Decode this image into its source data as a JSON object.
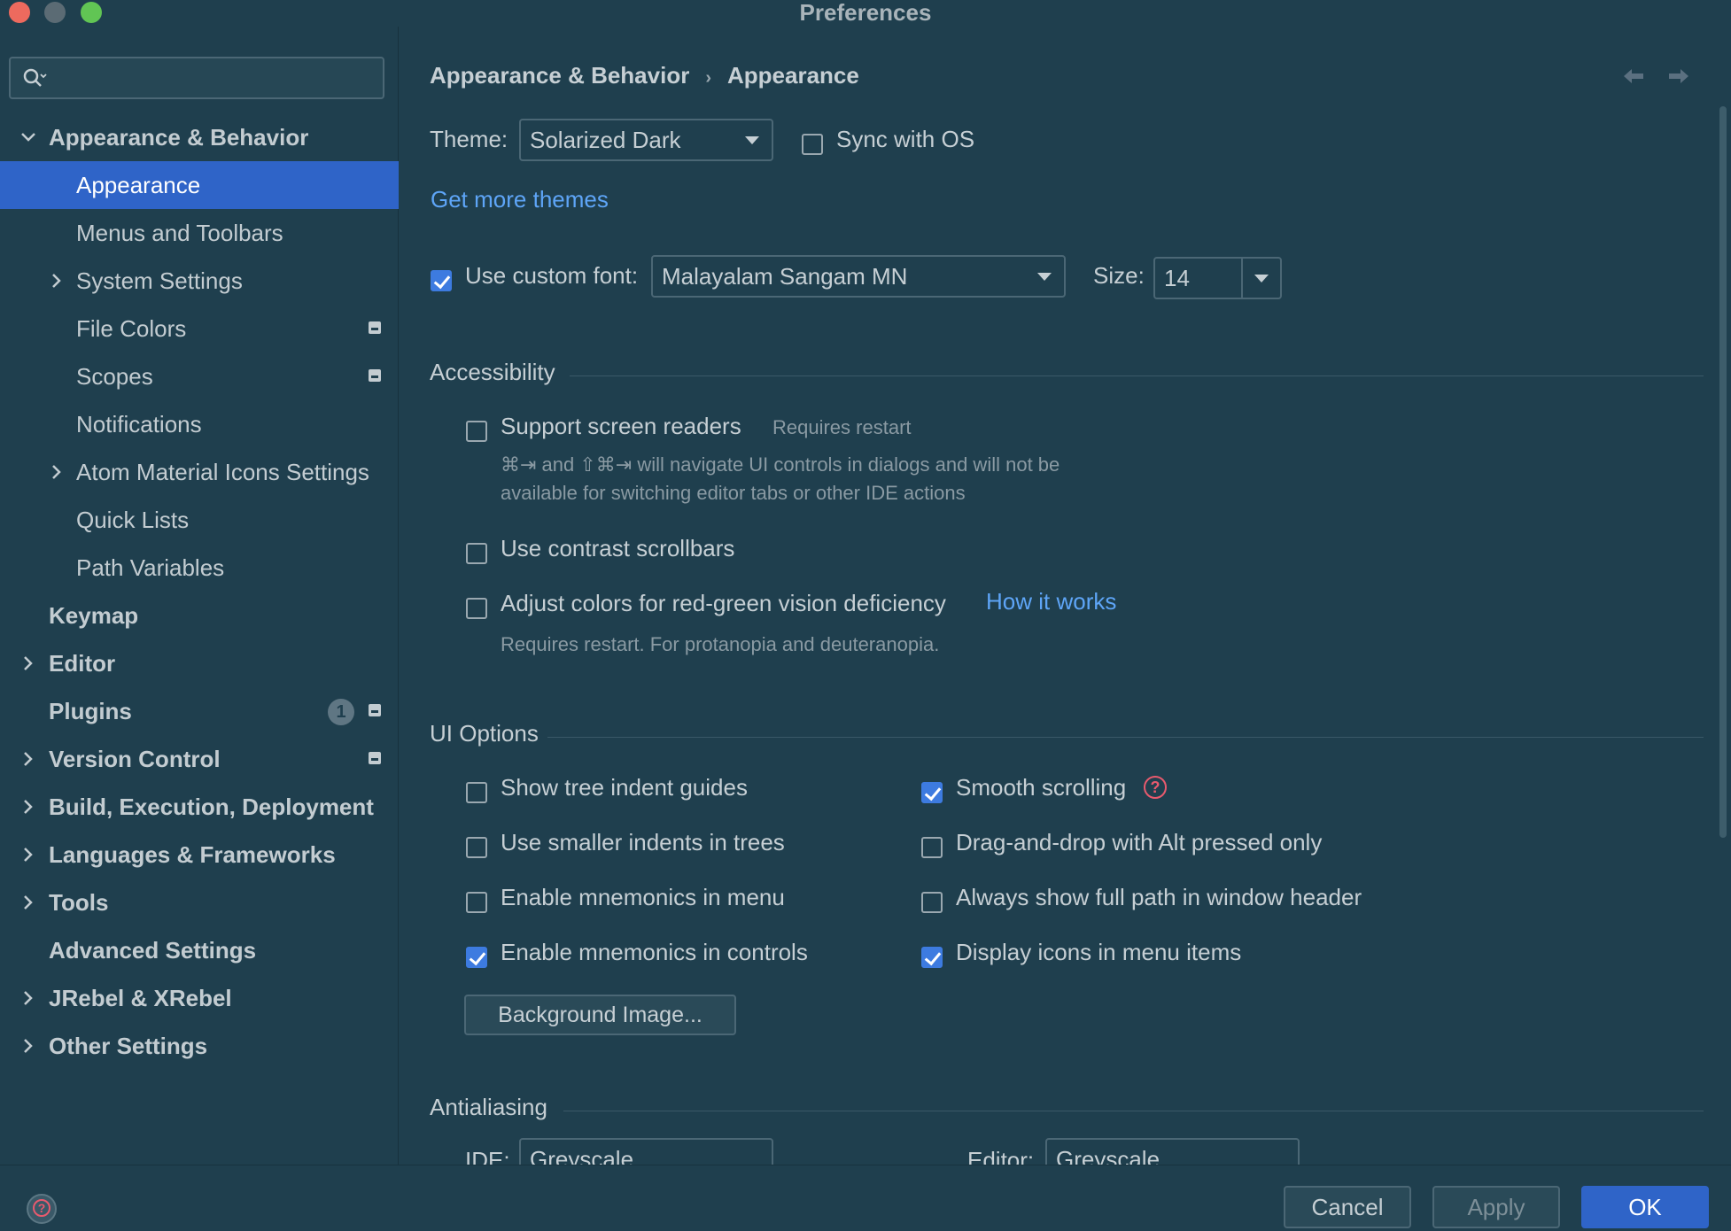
{
  "window": {
    "title": "Preferences"
  },
  "sidebar": {
    "search": {
      "placeholder": "",
      "value": ""
    },
    "items": [
      {
        "label": "Appearance & Behavior",
        "expanded": true
      },
      {
        "label": "Appearance",
        "selected": true
      },
      {
        "label": "Menus and Toolbars"
      },
      {
        "label": "System Settings",
        "collapsed": true
      },
      {
        "label": "File Colors",
        "project_icon": true
      },
      {
        "label": "Scopes",
        "project_icon": true
      },
      {
        "label": "Notifications"
      },
      {
        "label": "Atom Material Icons Settings",
        "collapsed": true
      },
      {
        "label": "Quick Lists"
      },
      {
        "label": "Path Variables"
      },
      {
        "label": "Keymap"
      },
      {
        "label": "Editor",
        "collapsed": true
      },
      {
        "label": "Plugins",
        "badge": "1",
        "project_icon": true
      },
      {
        "label": "Version Control",
        "collapsed": true,
        "project_icon": true
      },
      {
        "label": "Build, Execution, Deployment",
        "collapsed": true
      },
      {
        "label": "Languages & Frameworks",
        "collapsed": true
      },
      {
        "label": "Tools",
        "collapsed": true
      },
      {
        "label": "Advanced Settings"
      },
      {
        "label": "JRebel & XRebel",
        "collapsed": true
      },
      {
        "label": "Other Settings",
        "collapsed": true
      }
    ]
  },
  "main": {
    "breadcrumb": {
      "parent": "Appearance & Behavior",
      "separator": "›",
      "current": "Appearance"
    },
    "theme": {
      "label": "Theme:",
      "value": "Solarized Dark"
    },
    "sync_os": {
      "label": "Sync with OS",
      "checked": false
    },
    "more_themes": "Get more themes",
    "custom_font": {
      "label": "Use custom font:",
      "checked": true,
      "value": "Malayalam Sangam MN"
    },
    "size": {
      "label": "Size:",
      "value": "14"
    },
    "accessibility": {
      "title": "Accessibility",
      "screen_readers": {
        "label": "Support screen readers",
        "checked": false,
        "note": "Requires restart"
      },
      "screen_readers_desc_1": "⌘⇥ and ⇧⌘⇥ will navigate UI controls in dialogs and will not be",
      "screen_readers_desc_2": "available for switching editor tabs or other IDE actions",
      "contrast_scrollbars": {
        "label": "Use contrast scrollbars",
        "checked": false
      },
      "red_green": {
        "label": "Adjust colors for red-green vision deficiency",
        "checked": false,
        "link": "How it works"
      },
      "red_green_note": "Requires restart. For protanopia and deuteranopia."
    },
    "ui_options": {
      "title": "UI Options",
      "left": [
        {
          "label": "Show tree indent guides",
          "checked": false
        },
        {
          "label": "Use smaller indents in trees",
          "checked": false
        },
        {
          "label": "Enable mnemonics in menu",
          "checked": false
        },
        {
          "label": "Enable mnemonics in controls",
          "checked": true
        }
      ],
      "right": [
        {
          "label": "Smooth scrolling",
          "checked": true
        },
        {
          "label": "Drag-and-drop with Alt pressed only",
          "checked": false
        },
        {
          "label": "Always show full path in window header",
          "checked": false
        },
        {
          "label": "Display icons in menu items",
          "checked": true
        }
      ],
      "background_image": "Background Image..."
    },
    "antialiasing": {
      "title": "Antialiasing",
      "ide": {
        "label": "IDE:",
        "value": "Greyscale"
      },
      "editor": {
        "label": "Editor:",
        "value": "Greyscale"
      }
    }
  },
  "footer": {
    "cancel": "Cancel",
    "apply": "Apply",
    "ok": "OK"
  },
  "colors": {
    "background": "#1f3f4e",
    "selection": "#2f64c8",
    "link": "#5ea5f7",
    "checkbox_checked": "#3d7be0",
    "help_icon": "#e85a6e"
  }
}
